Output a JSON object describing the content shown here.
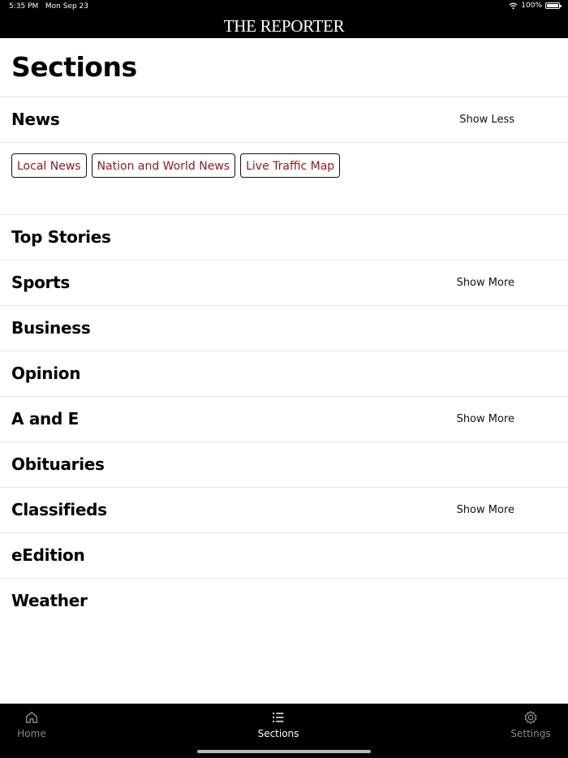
{
  "status_bar": {
    "time": "5:35 PM",
    "date": "Mon Sep 23",
    "battery": "100%"
  },
  "header": {
    "masthead": "THE REPORTER"
  },
  "page": {
    "title": "Sections"
  },
  "sections": [
    {
      "label": "News",
      "toggle": "Show Less"
    },
    {
      "label": "Top Stories",
      "toggle": ""
    },
    {
      "label": "Sports",
      "toggle": "Show More"
    },
    {
      "label": "Business",
      "toggle": ""
    },
    {
      "label": "Opinion",
      "toggle": ""
    },
    {
      "label": "A and E",
      "toggle": "Show More"
    },
    {
      "label": "Obituaries",
      "toggle": ""
    },
    {
      "label": "Classifieds",
      "toggle": "Show More"
    },
    {
      "label": "eEdition",
      "toggle": ""
    },
    {
      "label": "Weather",
      "toggle": ""
    }
  ],
  "news_subsections": [
    "Local News",
    "Nation and World News",
    "Live Traffic Map"
  ],
  "tabs": {
    "home": "Home",
    "sections": "Sections",
    "settings": "Settings"
  },
  "colors": {
    "accent": "#8b1a1f",
    "bar": "#000000",
    "inactive_tab": "#8a8a8a"
  }
}
